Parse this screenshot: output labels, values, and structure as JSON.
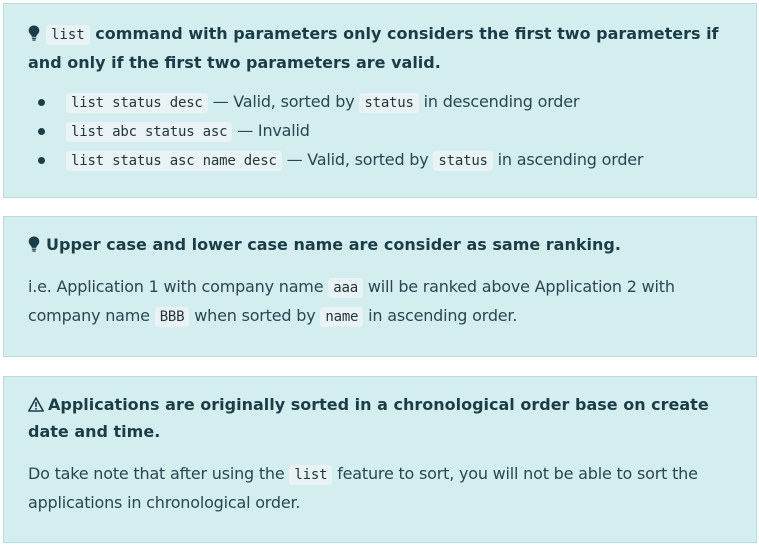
{
  "callout1": {
    "title_code": "list",
    "title_text": "command with parameters only considers the first two parameters if and only if the first two parameters are valid.",
    "items": [
      {
        "code": "list status desc",
        "text": "— Valid, sorted by",
        "code2": "status",
        "text2": "in descending order"
      },
      {
        "code": "list abc status asc",
        "text": "— Invalid"
      },
      {
        "code": "list status asc name desc",
        "text": "— Valid, sorted by",
        "code2": "status",
        "text2": "in ascending order"
      }
    ]
  },
  "callout2": {
    "title": "Upper case and lower case name are consider as same ranking.",
    "body": {
      "t1": "i.e. Application 1 with company name",
      "c1": "aaa",
      "t2": "will be ranked above Application 2 with company name",
      "c2": "BBB",
      "t3": "when sorted by",
      "c3": "name",
      "t4": "in ascending order."
    }
  },
  "callout3": {
    "title": "Applications are originally sorted in a chronological order base on create date and time.",
    "body": {
      "t1": "Do take note that after using the",
      "c1": "list",
      "t2": "feature to sort, you will not be able to sort the applications in chronological order."
    }
  }
}
